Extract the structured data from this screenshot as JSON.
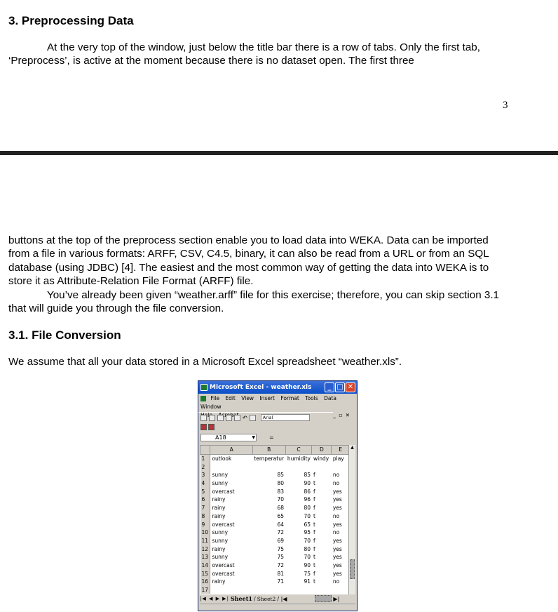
{
  "page": {
    "section_title": "3. Preprocessing Data",
    "para1": "At the very top of the window, just below the title bar there is a row of tabs. Only the first tab, ‘Preprocess’, is active at the moment because there is no dataset open. The first three",
    "page_number": "3",
    "para2": "buttons at the top of the preprocess section enable you to load data into WEKA. Data can be imported from a file in various formats: ARFF, CSV, C4.5, binary, it can also be read from a URL or from an SQL database (using JDBC) [4]. The easiest and the most common way of getting the data into WEKA is to store it as Attribute-Relation File Format (ARFF) file.",
    "para3": "You’ve already been given “weather.arff” file for this exercise; therefore, you can skip section 3.1 that will guide you through the file conversion.",
    "subsection_title": "3.1. File Conversion",
    "para4": "We assume that all your data stored in a Microsoft Excel spreadsheet “weather.xls”."
  },
  "excel": {
    "title": "Microsoft Excel - weather.xls",
    "menu": [
      "File",
      "Edit",
      "View",
      "Insert",
      "Format",
      "Tools",
      "Data",
      "Window",
      "Help",
      "Acrobat"
    ],
    "font_name": "Arial",
    "name_box": "A18",
    "formula_symbol": "=",
    "columns": [
      "A",
      "B",
      "C",
      "D",
      "E"
    ],
    "rows": [
      {
        "n": "1",
        "a": "outlook",
        "b": "temperatur",
        "c": "humidity",
        "d": "windy",
        "e": "play"
      },
      {
        "n": "2",
        "a": "",
        "b": "",
        "c": "",
        "d": "",
        "e": ""
      },
      {
        "n": "3",
        "a": "sunny",
        "b": "85",
        "c": "85",
        "d": "f",
        "e": "no"
      },
      {
        "n": "4",
        "a": "sunny",
        "b": "80",
        "c": "90",
        "d": "t",
        "e": "no"
      },
      {
        "n": "5",
        "a": "overcast",
        "b": "83",
        "c": "86",
        "d": "f",
        "e": "yes"
      },
      {
        "n": "6",
        "a": "rainy",
        "b": "70",
        "c": "96",
        "d": "f",
        "e": "yes"
      },
      {
        "n": "7",
        "a": "rainy",
        "b": "68",
        "c": "80",
        "d": "f",
        "e": "yes"
      },
      {
        "n": "8",
        "a": "rainy",
        "b": "65",
        "c": "70",
        "d": "t",
        "e": "no"
      },
      {
        "n": "9",
        "a": "overcast",
        "b": "64",
        "c": "65",
        "d": "t",
        "e": "yes"
      },
      {
        "n": "10",
        "a": "sunny",
        "b": "72",
        "c": "95",
        "d": "f",
        "e": "no"
      },
      {
        "n": "11",
        "a": "sunny",
        "b": "69",
        "c": "70",
        "d": "f",
        "e": "yes"
      },
      {
        "n": "12",
        "a": "rainy",
        "b": "75",
        "c": "80",
        "d": "f",
        "e": "yes"
      },
      {
        "n": "13",
        "a": "sunny",
        "b": "75",
        "c": "70",
        "d": "t",
        "e": "yes"
      },
      {
        "n": "14",
        "a": "overcast",
        "b": "72",
        "c": "90",
        "d": "t",
        "e": "yes"
      },
      {
        "n": "15",
        "a": "overcast",
        "b": "81",
        "c": "75",
        "d": "f",
        "e": "yes"
      },
      {
        "n": "16",
        "a": "rainy",
        "b": "71",
        "c": "91",
        "d": "t",
        "e": "no"
      },
      {
        "n": "17",
        "a": "",
        "b": "",
        "c": "",
        "d": "",
        "e": ""
      }
    ],
    "sheets": [
      "Sheet1",
      "Sheet2"
    ]
  }
}
